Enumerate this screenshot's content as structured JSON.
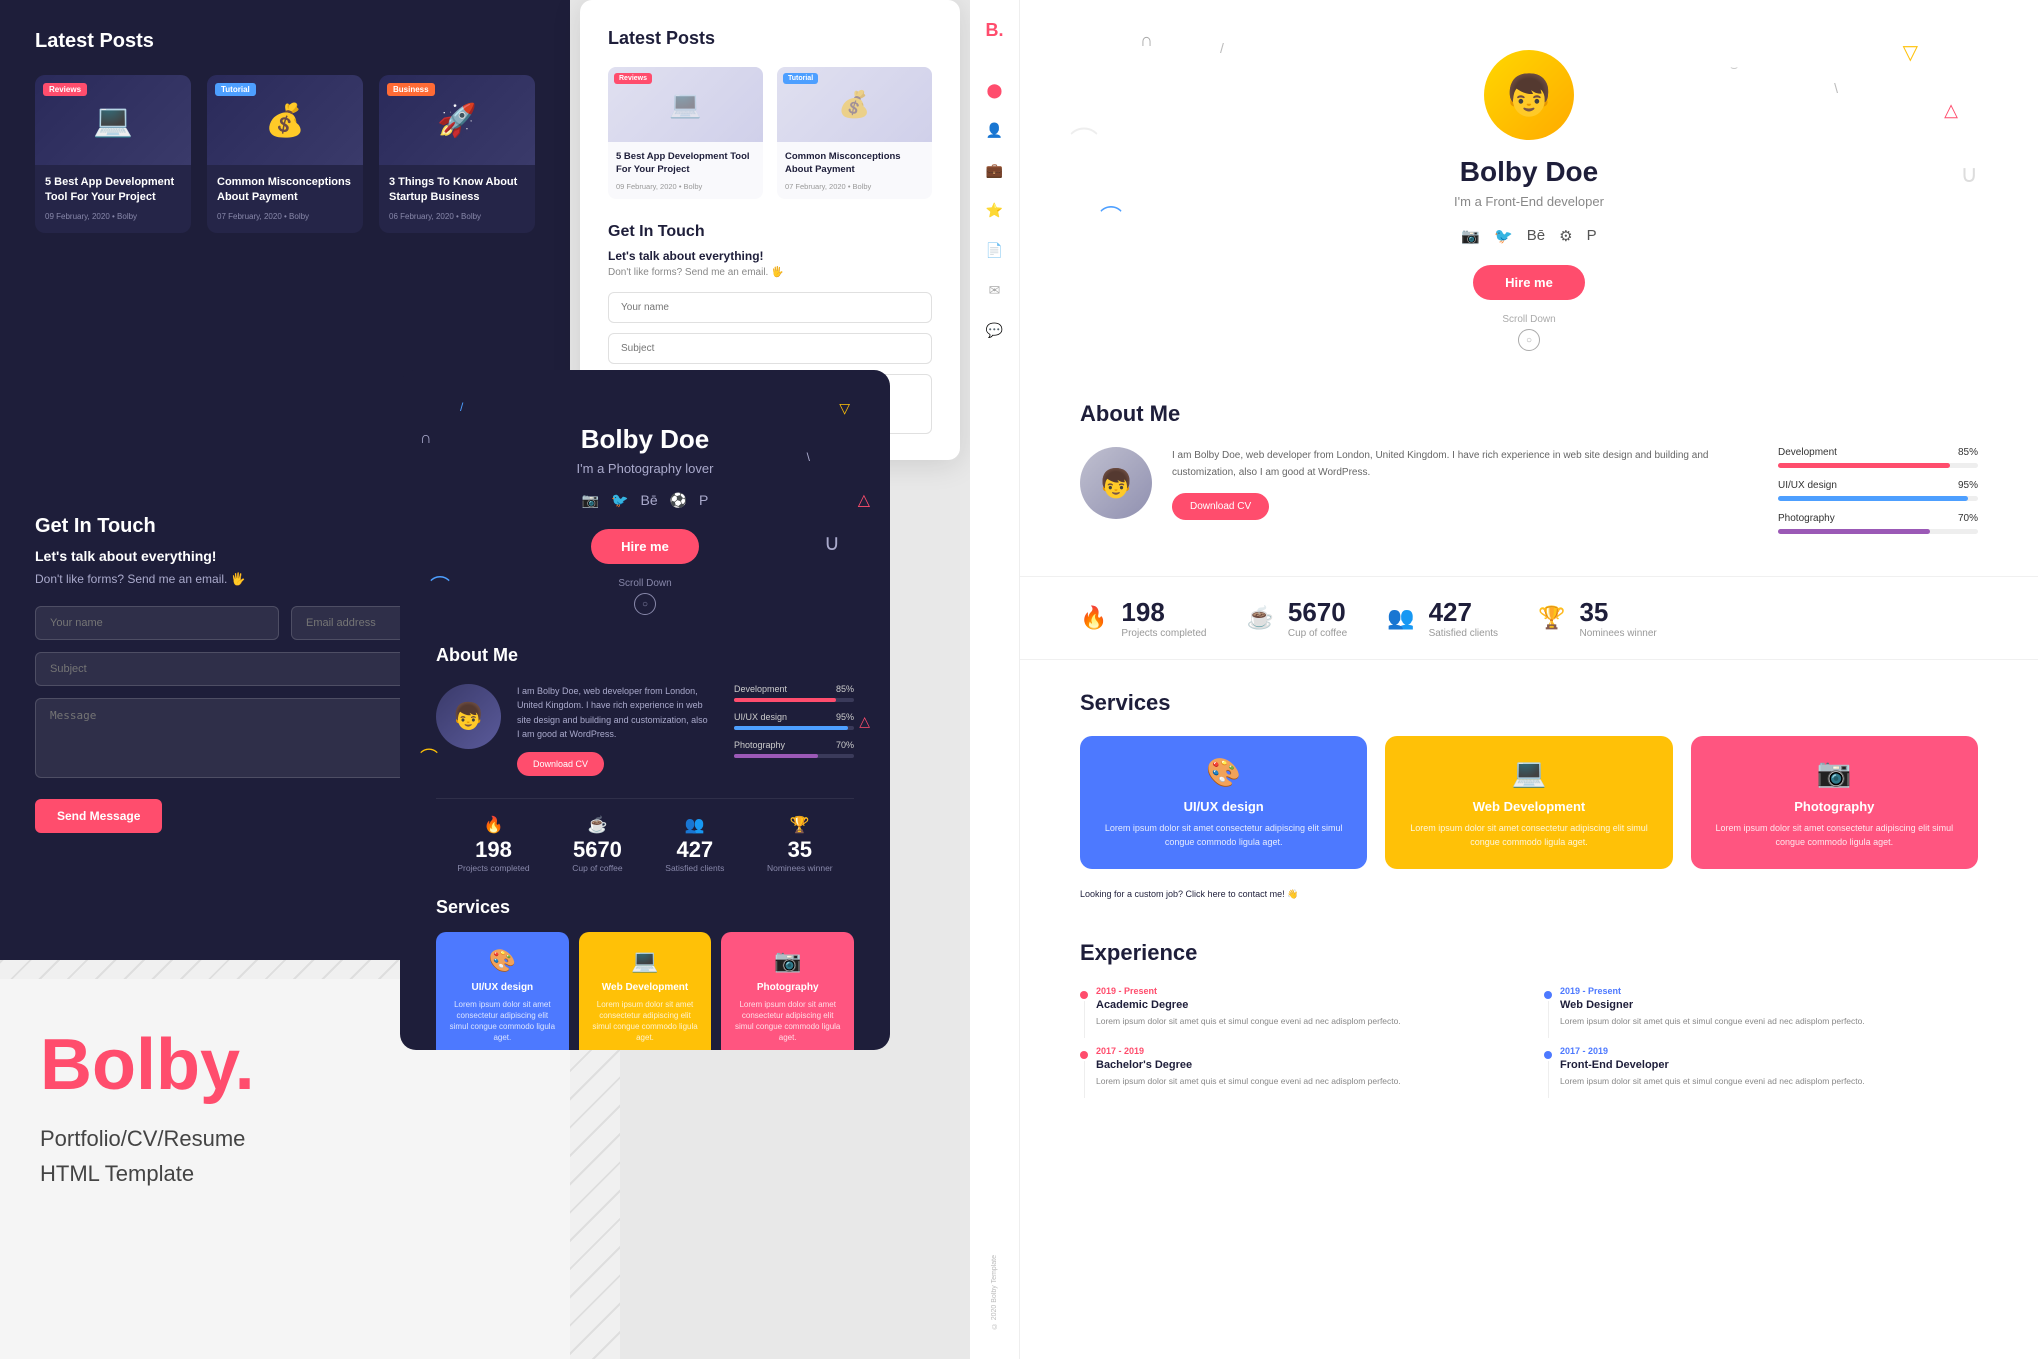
{
  "brand": {
    "name": "Bolby",
    "dot": ".",
    "subtitle1": "Portfolio/CV/Resume",
    "subtitle2": "HTML Template"
  },
  "sidebar": {
    "logo": "B.",
    "icons": [
      "👤",
      "💼",
      "📧",
      "📍",
      "📝",
      "💬"
    ],
    "copyright": "© 2020 Bolby Template"
  },
  "latestPosts": {
    "title": "Latest Posts",
    "posts": [
      {
        "badge": "Reviews",
        "badgeClass": "reviews",
        "title": "5 Best App Development Tool For Your Project",
        "date": "09 February, 2020",
        "author": "Bolby"
      },
      {
        "badge": "Tutorial",
        "badgeClass": "tutorial",
        "title": "Common Misconceptions About Payment",
        "date": "07 February, 2020",
        "author": "Bolby"
      },
      {
        "badge": "Business",
        "badgeClass": "business",
        "title": "3 Things To Know About Startup Business",
        "date": "06 February, 2020",
        "author": "Bolby"
      }
    ]
  },
  "contact": {
    "title": "Get In Touch",
    "subtitle": "Let's talk about everything!",
    "subtext": "Don't like forms? Send me an email. 🖐",
    "placeholders": {
      "name": "Your name",
      "email": "Email address",
      "subject": "Subject",
      "message": "Message"
    },
    "sendLabel": "Send Message"
  },
  "hero": {
    "name": "Bolby Doe",
    "role_dark": "I'm a Photography lover",
    "role_light": "I'm a Front-End developer",
    "hireLabel": "Hire me",
    "scrollLabel": "Scroll Down"
  },
  "about": {
    "title": "About Me",
    "text": "I am Bolby Doe, web developer from London, United Kingdom. I have rich experience in web site design and building and customization, also I am good at WordPress.",
    "downloadLabel": "Download CV",
    "skills": [
      {
        "name": "Development",
        "percent": "85%",
        "class": "dev"
      },
      {
        "name": "UI/UX design",
        "percent": "95%",
        "class": "ui"
      },
      {
        "name": "Photography",
        "percent": "70%",
        "class": "photo"
      }
    ]
  },
  "stats": [
    {
      "icon": "🔥",
      "number": "198",
      "label": "Projects completed"
    },
    {
      "icon": "☕",
      "number": "5670",
      "label": "Cup of coffee"
    },
    {
      "icon": "👥",
      "number": "427",
      "label": "Satisfied clients"
    },
    {
      "icon": "🏆",
      "number": "35",
      "label": "Nominees winner"
    }
  ],
  "services": {
    "title": "Services",
    "items": [
      {
        "icon": "🎨",
        "name": "UI/UX design",
        "desc": "Lorem ipsum dolor sit amet consectetur adipiscing elit simul congue commodo ligula aget.",
        "class": "blue"
      },
      {
        "icon": "💻",
        "name": "Web Development",
        "desc": "Lorem ipsum dolor sit amet consectetur adipiscing elit simul congue commodo ligula aget.",
        "class": "yellow"
      },
      {
        "icon": "📷",
        "name": "Photography",
        "desc": "Lorem ipsum dolor sit amet consectetur adipiscing elit simul congue commodo ligula aget.",
        "class": "pink"
      }
    ],
    "customLink": "Looking for a custom job? Click here to contact me! 👋"
  },
  "experience": {
    "title": "Experience",
    "left": [
      {
        "year": "2019 - Present",
        "title": "Academic Degree",
        "desc": "Lorem ipsum dolor sit amet quis et simul congue eveni ad nec adisplom perfecto.",
        "class": ""
      },
      {
        "year": "2017 - 2019",
        "title": "Bachelor's Degree",
        "desc": "Lorem ipsum dolor sit amet quis et simul congue eveni ad nec adisplom perfecto.",
        "class": ""
      }
    ],
    "right": [
      {
        "year": "2019 - Present",
        "title": "Web Designer",
        "desc": "Lorem ipsum dolor sit amet quis et simul congue eveni ad nec adisplom perfecto.",
        "class": "blue"
      },
      {
        "year": "2017 - 2019",
        "title": "Front-End Developer",
        "desc": "Lorem ipsum dolor sit amet quis et simul congue eveni ad nec adisplom perfecto.",
        "class": "blue"
      }
    ]
  }
}
